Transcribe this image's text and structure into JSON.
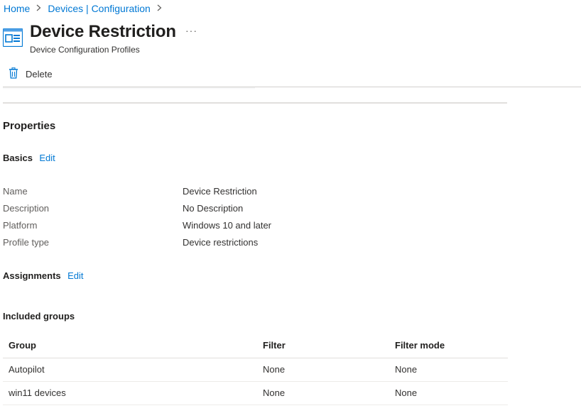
{
  "breadcrumb": {
    "items": [
      "Home",
      "Devices | Configuration"
    ]
  },
  "header": {
    "icon": "device-configuration-icon",
    "title": "Device Restriction",
    "more": "···",
    "subtitle": "Device Configuration Profiles"
  },
  "commands": {
    "delete_label": "Delete",
    "delete_icon": "trash-icon"
  },
  "properties": {
    "heading": "Properties",
    "basics": {
      "title": "Basics",
      "edit": "Edit",
      "rows": [
        {
          "label": "Name",
          "value": "Device Restriction"
        },
        {
          "label": "Description",
          "value": "No Description"
        },
        {
          "label": "Platform",
          "value": "Windows 10 and later"
        },
        {
          "label": "Profile type",
          "value": "Device restrictions"
        }
      ]
    },
    "assignments": {
      "title": "Assignments",
      "edit": "Edit"
    },
    "included_groups": {
      "title": "Included groups",
      "columns": [
        "Group",
        "Filter",
        "Filter mode"
      ],
      "rows": [
        [
          "Autopilot",
          "None",
          "None"
        ],
        [
          "win11 devices",
          "None",
          "None"
        ]
      ]
    }
  },
  "colors": {
    "accent": "#0078d4",
    "text": "#323130",
    "muted": "#605e5c"
  }
}
